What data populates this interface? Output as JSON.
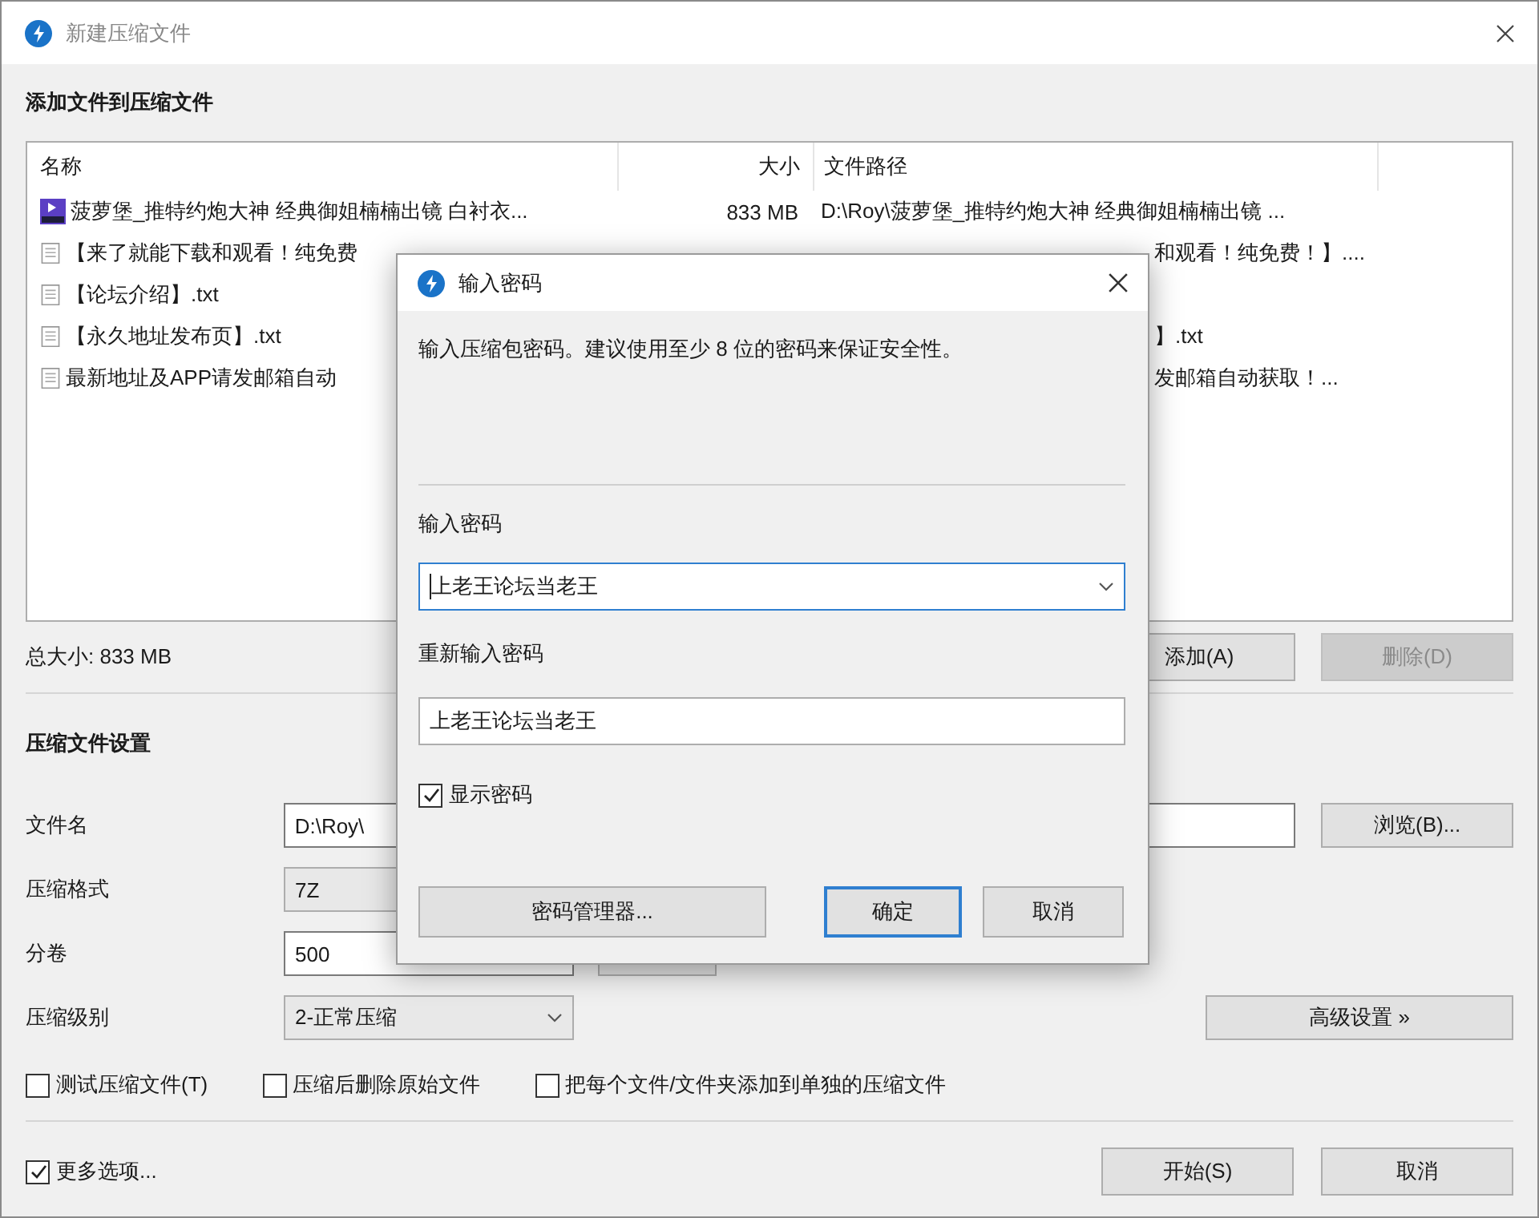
{
  "window": {
    "title": "新建压缩文件"
  },
  "add_section": {
    "title": "添加文件到压缩文件"
  },
  "file_list": {
    "columns": [
      "名称",
      "大小",
      "文件路径"
    ],
    "rows": [
      {
        "kind": "video",
        "name": "菠萝堡_推特约炮大神  经典御姐楠楠出镜 白衬衣...",
        "size": "833 MB",
        "path": "D:\\Roy\\菠萝堡_推特约炮大神  经典御姐楠楠出镜 ...",
        "clipped": false
      },
      {
        "kind": "text",
        "name": "【来了就能下载和观看！纯免费",
        "path": "和观看！纯免费！】....",
        "clipped": true
      },
      {
        "kind": "text",
        "name": "【论坛介绍】.txt"
      },
      {
        "kind": "text",
        "name": "【永久地址发布页】.txt",
        "path": "】.txt",
        "clipped": true
      },
      {
        "kind": "text",
        "name": "最新地址及APP请发邮箱自动",
        "path": "发邮箱自动获取！...",
        "clipped": true
      }
    ]
  },
  "total_size": "总大小: 833 MB",
  "list_buttons": [
    {
      "label": "添加(A)",
      "disabled": false
    },
    {
      "label": "删除(D)",
      "disabled": true
    }
  ],
  "settings": {
    "title": "压缩文件设置",
    "file_name": {
      "label": "文件名",
      "value": "D:\\Roy\\",
      "button": "浏览(B)..."
    },
    "format": {
      "label": "压缩格式",
      "value": "7Z"
    },
    "split": {
      "label": "分卷",
      "value": "500"
    },
    "level": {
      "label": "压缩级别",
      "value": "2-正常压缩",
      "button": "高级设置 »"
    },
    "options": [
      {
        "label": "测试压缩文件(T)",
        "checked": false
      },
      {
        "label": "压缩后删除原始文件",
        "checked": false
      },
      {
        "label": "把每个文件/文件夹添加到单独的压缩文件",
        "checked": false
      }
    ]
  },
  "more_options": {
    "label": "更多选项...",
    "checked": true
  },
  "buttons": [
    "开始(S)",
    "取消"
  ],
  "dialog": {
    "title": "输入密码",
    "description": "输入压缩包密码。建议使用至少 8 位的密码来保证安全性。",
    "password_label": "输入密码",
    "password": "上老王论坛当老王",
    "repeat_label": "重新输入密码",
    "repeat": "上老王论坛当老王",
    "show_password": {
      "label": "显示密码",
      "checked": true
    },
    "buttons": [
      {
        "label": "密码管理器...",
        "kind": "plain"
      },
      {
        "label": "确定",
        "kind": "default"
      },
      {
        "label": "取消",
        "kind": "plain"
      }
    ]
  }
}
